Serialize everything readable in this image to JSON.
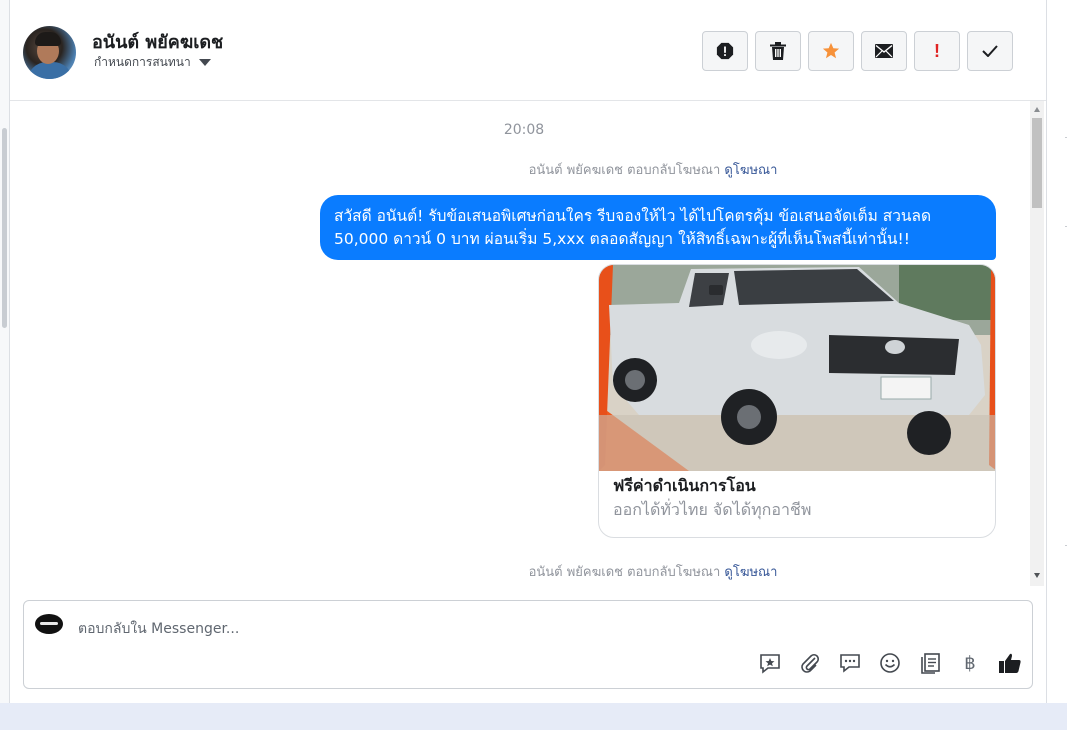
{
  "header": {
    "contact_name": "อนันต์ พยัคฆเดช",
    "assign_label": "กำหนดการสนทนา",
    "actions": [
      {
        "name": "spam-button",
        "icon": "alert-octagon-icon"
      },
      {
        "name": "delete-button",
        "icon": "trash-icon"
      },
      {
        "name": "star-button",
        "icon": "star-icon",
        "color": "#f7923a"
      },
      {
        "name": "mark-unread-button",
        "icon": "envelope-icon"
      },
      {
        "name": "follow-up-button",
        "icon": "exclamation-icon",
        "color": "#e02424"
      },
      {
        "name": "mark-done-button",
        "icon": "checkmark-icon"
      }
    ]
  },
  "thread": {
    "timestamp": "20:08",
    "reply_note_prefix": "อนันต์ พยัคฆเดช ตอบกลับโฆษณา",
    "reply_note_link": "ดูโฆษณา",
    "message_text": "สวัสดี อนันต์! รับข้อเสนอพิเศษก่อนใคร รีบจองให้ไว ได้ไปโคตรคุ้ม ข้อเสนอจัดเต็ม สวนลด 50,000 ดาวน์ 0 บาท ผ่อนเริ่ม 5,xxx ตลอดสัญญา ให้สิทธิ์เฉพาะผู้ที่เห็นโพสนี้เท่านั้น!!",
    "bubble_color": "#0a7cff",
    "card": {
      "title": "ฟรีค่าดำเนินการโอน",
      "subtitle": "ออกได้ทั่วไทย จัดได้ทุกอาชีพ",
      "image_icon": "pickup-truck-photo"
    }
  },
  "composer": {
    "placeholder": "ตอบกลับใน Messenger...",
    "tools": [
      "saved-reply-icon",
      "attachment-icon",
      "chat-bubbles-icon",
      "emoji-icon",
      "forms-icon",
      "baht-icon",
      "thumbs-up-icon"
    ],
    "baht_symbol": "฿"
  }
}
